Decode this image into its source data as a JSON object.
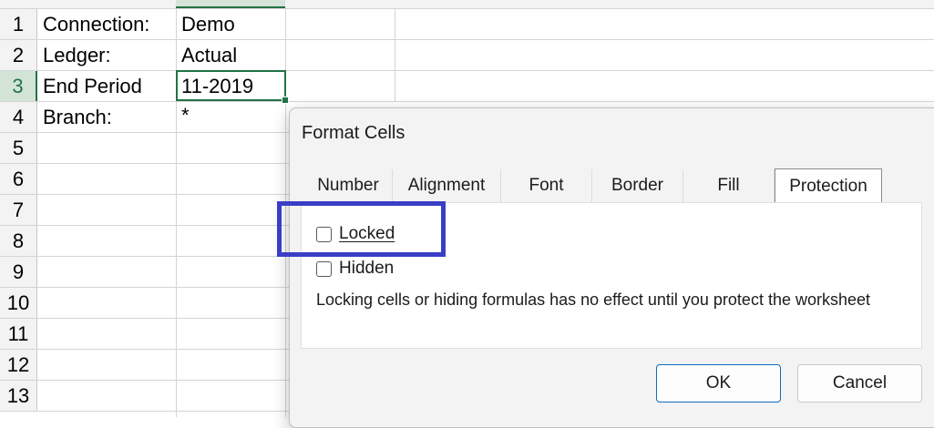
{
  "sheet": {
    "rows": [
      "1",
      "2",
      "3",
      "4",
      "5",
      "6",
      "7",
      "8",
      "9",
      "10",
      "11",
      "12",
      "13"
    ],
    "cells": {
      "a1": "Connection:",
      "b1": "Demo",
      "a2": "Ledger:",
      "b2": "Actual",
      "a3": "End Period",
      "b3": "11-2019",
      "a4": "Branch:",
      "b4": "*"
    },
    "accent_color": "#217346"
  },
  "dialog": {
    "title": "Format Cells",
    "tabs": [
      {
        "label": "Number"
      },
      {
        "label": "Alignment"
      },
      {
        "label": "Font"
      },
      {
        "label": "Border"
      },
      {
        "label": "Fill"
      },
      {
        "label": "Protection",
        "active": true
      }
    ],
    "locked_label": "Locked",
    "locked_checked": false,
    "hidden_label": "Hidden",
    "hidden_checked": false,
    "note": "Locking cells or hiding formulas has no effect until you protect the worksheet",
    "ok_label": "OK",
    "cancel_label": "Cancel"
  },
  "annotation": {
    "highlight_color": "#3a3ec7"
  }
}
